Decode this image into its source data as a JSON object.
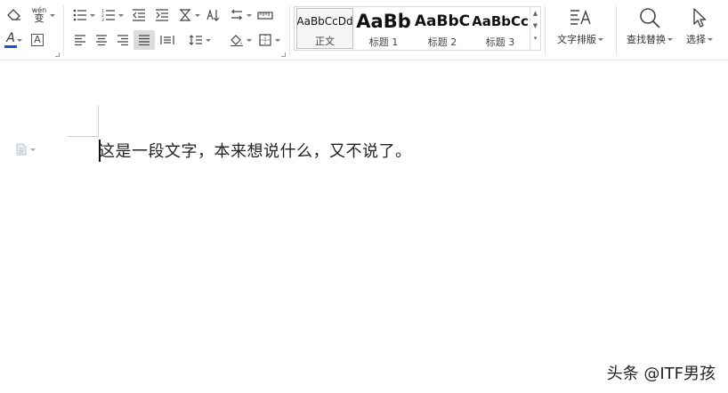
{
  "ribbon": {
    "font_group": {
      "clear_format_glyph": "⌫",
      "phonetic_glyph": "wén",
      "phonetic_char": "变",
      "font_color_glyph": "A",
      "char_border_glyph": "A",
      "font_color": "#1f4fd1"
    },
    "styles": [
      {
        "sample": "AaBbCcDd",
        "name": "正文"
      },
      {
        "sample": "AaBb",
        "name": "标题 1"
      },
      {
        "sample": "AaBbC",
        "name": "标题 2"
      },
      {
        "sample": "AaBbCc",
        "name": "标题 3"
      }
    ],
    "text_layout_label": "文字排版",
    "find_replace_label": "查找替换",
    "select_label": "选择"
  },
  "document": {
    "paragraph_text": "这是一段文字，本来想说什么，又不说了。"
  },
  "watermark": "头条 @ITF男孩"
}
